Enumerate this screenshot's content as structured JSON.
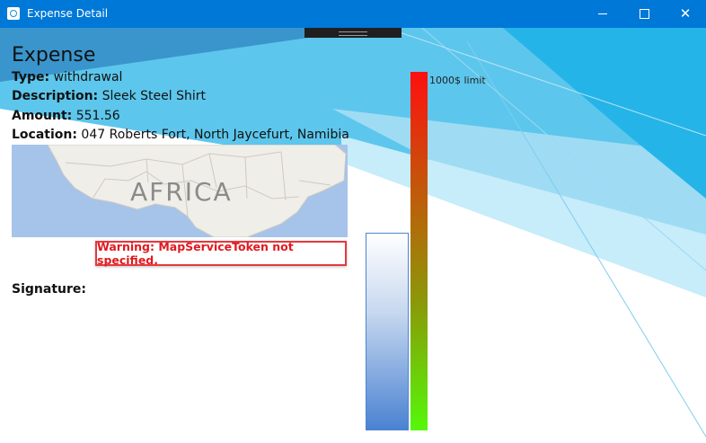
{
  "window": {
    "title": "Expense Detail",
    "close_glyph": "✕"
  },
  "expense": {
    "heading": "Expense",
    "type_label": "Type:",
    "type_value": "withdrawal",
    "description_label": "Description:",
    "description_value": "Sleek Steel Shirt",
    "amount_label": "Amount:",
    "amount_value": "551.56",
    "location_label": "Location:",
    "location_value": "047 Roberts Fort, North Jaycefurt, Namibia"
  },
  "map": {
    "region_label": "AFRICA",
    "warning": "Warning: MapServiceToken not specified."
  },
  "signature": {
    "label": "Signature:"
  },
  "budget": {
    "limit_label": "1000$ limit",
    "amount_fraction": 0.55156
  },
  "colors": {
    "titlebar": "#0078d7",
    "warning_text": "#e0191f",
    "warning_border": "#e5393e",
    "limit_top": "#ff0f0f",
    "limit_bottom": "#55f80a",
    "amount_bar": "#4a82d2"
  },
  "icons": {
    "app": "app-icon",
    "minimize": "minimize-icon",
    "maximize": "maximize-icon",
    "close": "close-icon"
  }
}
